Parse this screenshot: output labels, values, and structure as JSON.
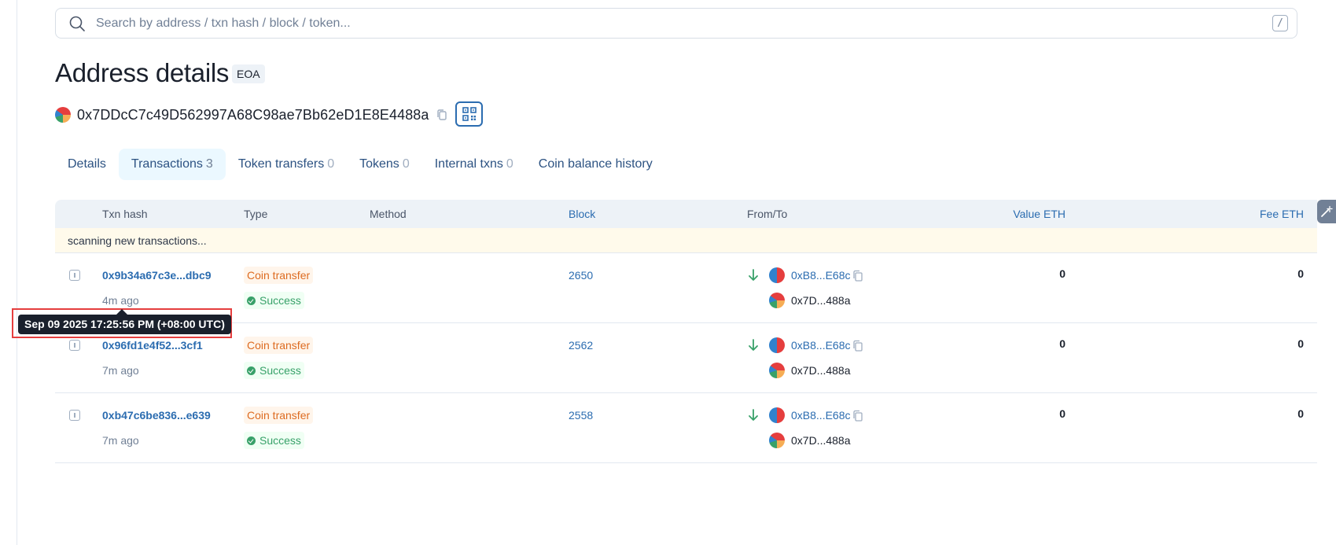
{
  "search": {
    "placeholder": "Search by address / txn hash / block / token...",
    "shortcut": "/"
  },
  "header": {
    "title": "Address details",
    "tag": "EOA"
  },
  "address": {
    "full": "0x7DDcC7c49D562997A68C98ae7Bb62eD1E8E4488a"
  },
  "tabs": [
    {
      "label": "Details",
      "count": ""
    },
    {
      "label": "Transactions",
      "count": "3"
    },
    {
      "label": "Token transfers",
      "count": "0"
    },
    {
      "label": "Tokens",
      "count": "0"
    },
    {
      "label": "Internal txns",
      "count": "0"
    },
    {
      "label": "Coin balance history",
      "count": ""
    }
  ],
  "table": {
    "columns": {
      "txn_hash": "Txn hash",
      "type": "Type",
      "method": "Method",
      "block": "Block",
      "from_to": "From/To",
      "value": "Value ETH",
      "fee": "Fee ETH"
    },
    "scanning": "scanning new transactions...",
    "rows": [
      {
        "hash": "0x9b34a67c3e...dbc9",
        "age": "4m ago",
        "type": "Coin transfer",
        "status": "Success",
        "block": "2650",
        "from": "0xB8...E68c",
        "to": "0x7D...488a",
        "value": "0",
        "fee": "0"
      },
      {
        "hash": "0x96fd1e4f52...3cf1",
        "age": "7m ago",
        "type": "Coin transfer",
        "status": "Success",
        "block": "2562",
        "from": "0xB8...E68c",
        "to": "0x7D...488a",
        "value": "0",
        "fee": "0"
      },
      {
        "hash": "0xb47c6be836...e639",
        "age": "7m ago",
        "type": "Coin transfer",
        "status": "Success",
        "block": "2558",
        "from": "0xB8...E68c",
        "to": "0x7D...488a",
        "value": "0",
        "fee": "0"
      }
    ]
  },
  "tooltip": {
    "text": "Sep 09 2025 17:25:56 PM (+08:00 UTC)"
  },
  "colors": {
    "link": "#2b6cb0",
    "type_tag": "#dd6b20",
    "success": "#38a169",
    "highlight_frame": "#e53e3e",
    "active_tab_bg": "#ebf8ff"
  }
}
